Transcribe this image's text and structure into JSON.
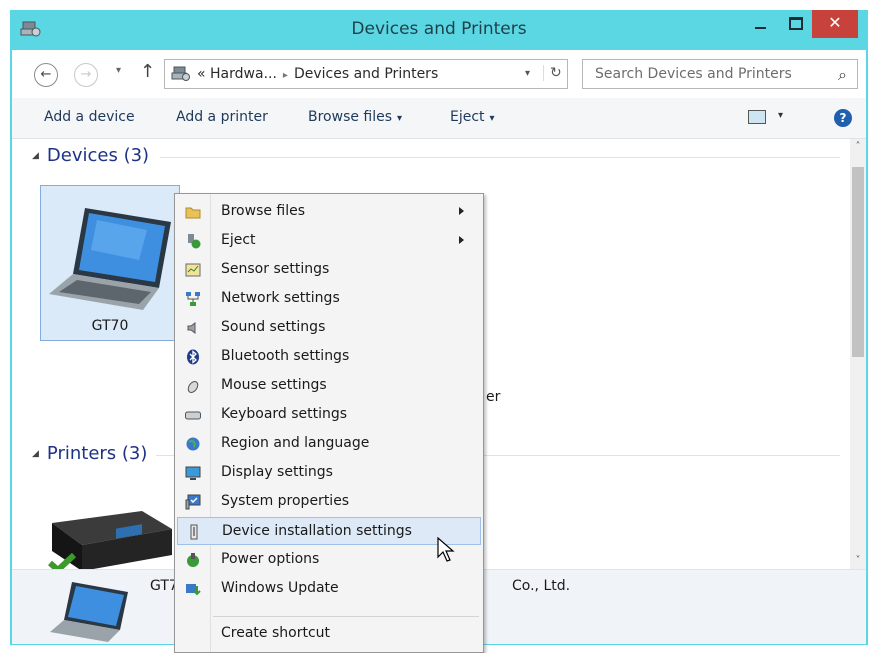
{
  "window": {
    "title": "Devices and Printers",
    "close_glyph": "✕",
    "accent_color": "#5bd7e3",
    "close_color": "#c6423a"
  },
  "nav": {
    "back_glyph": "←",
    "forward_glyph": "→",
    "recent_glyph": "▾",
    "up_glyph": "↑"
  },
  "address": {
    "prefix": "«",
    "crumb_1": "Hardwa...",
    "crumb_sep": "▸",
    "crumb_2": "Devices and Printers",
    "dropdown_glyph": "▾",
    "refresh_glyph": "↻"
  },
  "search": {
    "placeholder": "Search Devices and Printers",
    "icon_glyph": "⌕"
  },
  "toolbar": {
    "add_device": "Add a device",
    "add_printer": "Add a printer",
    "browse_files": "Browse files",
    "eject": "Eject",
    "dropdown_glyph": "▾",
    "help_glyph": "?"
  },
  "groups": {
    "devices": "Devices (3)",
    "printers": "Printers (3)",
    "collapse_glyph": "◢"
  },
  "devices": [
    {
      "label": "GT70",
      "icon": "laptop-icon"
    }
  ],
  "peek": {
    "device_fragment": "er",
    "details_name": "GT7",
    "details_manufacturer": "Co., Ltd."
  },
  "scrollbar": {
    "up_glyph": "˄",
    "down_glyph": "˅"
  },
  "context_menu": {
    "submenu_items": [
      0,
      1
    ],
    "items": [
      {
        "label": "Browse files",
        "icon": "folder-icon"
      },
      {
        "label": "Eject",
        "icon": "eject-icon"
      },
      {
        "label": "Sensor settings",
        "icon": "sensor-icon"
      },
      {
        "label": "Network settings",
        "icon": "network-icon"
      },
      {
        "label": "Sound settings",
        "icon": "speaker-icon"
      },
      {
        "label": "Bluetooth settings",
        "icon": "bluetooth-icon"
      },
      {
        "label": "Mouse settings",
        "icon": "mouse-icon"
      },
      {
        "label": "Keyboard settings",
        "icon": "keyboard-icon"
      },
      {
        "label": "Region and language",
        "icon": "globe-icon"
      },
      {
        "label": "Display settings",
        "icon": "display-icon"
      },
      {
        "label": "System properties",
        "icon": "system-icon"
      },
      {
        "label": "Device installation settings",
        "icon": "usb-device-icon"
      },
      {
        "label": "Power options",
        "icon": "power-icon"
      },
      {
        "label": "Windows Update",
        "icon": "update-icon"
      },
      {
        "label": "Create shortcut",
        "icon": ""
      }
    ],
    "hovered_item": "Device installation settings"
  }
}
